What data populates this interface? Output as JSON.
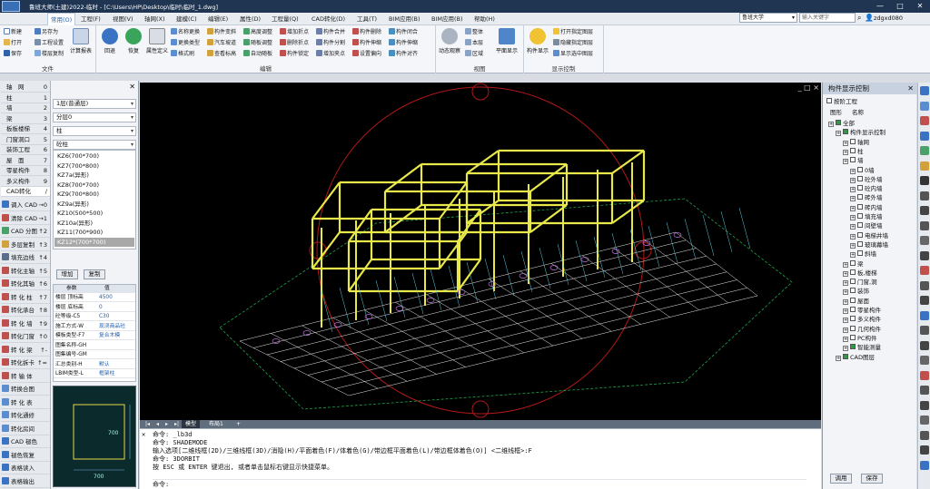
{
  "window": {
    "title": "鲁班大师(土建)2022-临时 - [C:\\Users\\HP\\Desktop\\临时\\临时_1.dwg]",
    "min": "—",
    "max": "□",
    "close": "✕"
  },
  "menu": {
    "items": [
      "常用(O)",
      "工程(F)",
      "视图(V)",
      "轴网(X)",
      "建模(C)",
      "编辑(E)",
      "属性(D)",
      "工程量(Q)",
      "CAD转化(D)",
      "工具(T)",
      "BIM应用(B)",
      "BIM应用(B)",
      "帮助(H)"
    ],
    "active_index": 0,
    "font_select": "鲁班大学",
    "search_placeholder": "输入关键字",
    "user": "zdgxd080"
  },
  "ribbon": {
    "file": {
      "label": "文件",
      "buttons": [
        "新建",
        "另存为",
        "打开",
        "工程设置",
        "保存",
        "楼层复制"
      ],
      "big": "计算报表"
    },
    "edit": {
      "label": "编辑",
      "big": [
        "回退",
        "恢复",
        "属性定义"
      ],
      "buttons": [
        "名称更换",
        "构件变斜",
        "高度调整",
        "增加折点",
        "构件合并",
        "构件删除",
        "构件闭合",
        "更换类型",
        "汽车坡道",
        "随板调整",
        "删除折点",
        "构件分割",
        "构件伸缩",
        "构件伸缩",
        "格式刷",
        "查看标高",
        "自动随板",
        "构件锁定",
        "增加夹点",
        "设置偏向",
        "构件对齐"
      ]
    },
    "view": {
      "label": "视图",
      "big": [
        "动态观察",
        "平面显示"
      ],
      "buttons": [
        "整体",
        "本层",
        "区域"
      ]
    },
    "display": {
      "label": "显示控制",
      "big": "构件显示",
      "buttons": [
        "打开指定图层",
        "隐藏指定图层",
        "显示选中图层"
      ]
    }
  },
  "left_strip": {
    "items": [
      {
        "label": "轴　网",
        "key": "0"
      },
      {
        "label": "柱",
        "key": "1"
      },
      {
        "label": "墙",
        "key": "2"
      },
      {
        "label": "梁",
        "key": "3"
      },
      {
        "label": "板板楼梯",
        "key": "4"
      },
      {
        "label": "门窗洞口",
        "key": "5"
      },
      {
        "label": "装饰工程",
        "key": "6"
      },
      {
        "label": "屋　面",
        "key": "7"
      },
      {
        "label": "零星构件",
        "key": "8"
      },
      {
        "label": "多义构件",
        "key": "9"
      },
      {
        "label": "CAD转化",
        "key": "/"
      }
    ],
    "cad_items": [
      {
        "label": "调入 CAD",
        "key": "→0"
      },
      {
        "label": "清除 CAD",
        "key": "→1"
      },
      {
        "label": "CAD 分图",
        "key": "↑2"
      },
      {
        "label": "多层复制",
        "key": "↑3"
      },
      {
        "label": "填充边线",
        "key": "↑4"
      },
      {
        "label": "转化主轴",
        "key": "↑5"
      },
      {
        "label": "转化其轴",
        "key": "↑6"
      },
      {
        "label": "转 化 柱",
        "key": "↑7"
      },
      {
        "label": "转化承台",
        "key": "↑8"
      },
      {
        "label": "转 化 墙",
        "key": "↑9"
      },
      {
        "label": "转化门窗",
        "key": "↑0"
      },
      {
        "label": "转 化 梁",
        "key": "↑-"
      },
      {
        "label": "转化拆卡",
        "key": "↑="
      },
      {
        "label": "转 输 体",
        "key": ""
      },
      {
        "label": "转换合图",
        "key": ""
      },
      {
        "label": "转 化 表",
        "key": ""
      },
      {
        "label": "转化通修",
        "key": ""
      },
      {
        "label": "转化房间",
        "key": ""
      },
      {
        "label": "CAD 褪色",
        "key": ""
      },
      {
        "label": "褪色恢复",
        "key": ""
      },
      {
        "label": "表格读入",
        "key": ""
      },
      {
        "label": "表格输出",
        "key": ""
      }
    ]
  },
  "panel2": {
    "floor": "1层(普通层)",
    "layer": "分层0",
    "type": "柱",
    "subtype": "砼柱",
    "elements": [
      "KZ6(700*700)",
      "KZ7(700*800)",
      "KZ7a(异形)",
      "KZ8(700*700)",
      "KZ9(700*800)",
      "KZ9a(异形)",
      "KZ10(500*500)",
      "KZ10a(异形)",
      "KZ11(700*900)",
      "KZ12*(700*700)"
    ],
    "selected_index": 9,
    "add_btn": "增加",
    "copy_btn": "复制",
    "table_head": [
      "参数",
      "值"
    ],
    "props": [
      [
        "楼层 顶标高",
        "4500"
      ],
      [
        "楼层 底标高",
        "0"
      ],
      [
        "砼等级-C5",
        "C30"
      ],
      [
        "施工方式-W",
        "现浇商品砼"
      ],
      [
        "模板类型-F7",
        "复合木模"
      ],
      [
        "图集名称-GH",
        ""
      ],
      [
        "图集编号-GM",
        ""
      ],
      [
        "汇总类别-H",
        "默认"
      ],
      [
        "LBIM类型-L",
        "框架柱"
      ]
    ],
    "dim_w": "700",
    "dim_h": "700"
  },
  "viewport": {
    "controls": "_ □ ×"
  },
  "layout_tabs": {
    "nav": [
      "|◂",
      "◂",
      "▸",
      "▸|"
    ],
    "tabs": [
      "模型",
      "布局1",
      "+"
    ],
    "active": 0
  },
  "command": {
    "lines": [
      "命令: _lb3d",
      "命令: SHADEMODE",
      "输入选项[二维线框(2D)/三维线框(3D)/消隐(H)/平面着色(F)/体着色(G)/带边框平面着色(L)/带边框体着色(O)] <二维线框>:F",
      "命令: 3DORBIT",
      "按 ESC 或 ENTER 键退出, 或者单击鼠标右键显示快捷菜单。"
    ],
    "prompt": "命令:"
  },
  "right_panel": {
    "title": "构件显示控制",
    "checkbox_label": "按阶工程",
    "col1": "图形",
    "col2": "名称",
    "tree": [
      {
        "label": "全部",
        "level": 0,
        "on": true
      },
      {
        "label": "构件显示控制",
        "level": 1,
        "on": true
      },
      {
        "label": "轴网",
        "level": 2,
        "on": false
      },
      {
        "label": "柱",
        "level": 2,
        "on": false
      },
      {
        "label": "墙",
        "level": 2,
        "on": false
      },
      {
        "label": "0墙",
        "level": 3,
        "on": false
      },
      {
        "label": "砼外墙",
        "level": 3,
        "on": false
      },
      {
        "label": "砼内墙",
        "level": 3,
        "on": false
      },
      {
        "label": "砖外墙",
        "level": 3,
        "on": false
      },
      {
        "label": "砖内墙",
        "level": 3,
        "on": false
      },
      {
        "label": "填充墙",
        "level": 3,
        "on": false
      },
      {
        "label": "间壁墙",
        "level": 3,
        "on": false
      },
      {
        "label": "电梯井墙",
        "level": 3,
        "on": false
      },
      {
        "label": "玻璃幕墙",
        "level": 3,
        "on": false
      },
      {
        "label": "斜墙",
        "level": 3,
        "on": false
      },
      {
        "label": "梁",
        "level": 2,
        "on": false
      },
      {
        "label": "板,楼梯",
        "level": 2,
        "on": false
      },
      {
        "label": "门窗,洞",
        "level": 2,
        "on": false
      },
      {
        "label": "装饰",
        "level": 2,
        "on": false
      },
      {
        "label": "屋面",
        "level": 2,
        "on": false
      },
      {
        "label": "零星构件",
        "level": 2,
        "on": false
      },
      {
        "label": "多义构件",
        "level": 2,
        "on": false
      },
      {
        "label": "几何构件",
        "level": 2,
        "on": false
      },
      {
        "label": "PC构件",
        "level": 2,
        "on": false
      },
      {
        "label": "智能测量",
        "level": 2,
        "on": true
      },
      {
        "label": "CAD图层",
        "level": 1,
        "on": true
      }
    ],
    "apply_btn": "调用",
    "save_btn": "保存"
  }
}
